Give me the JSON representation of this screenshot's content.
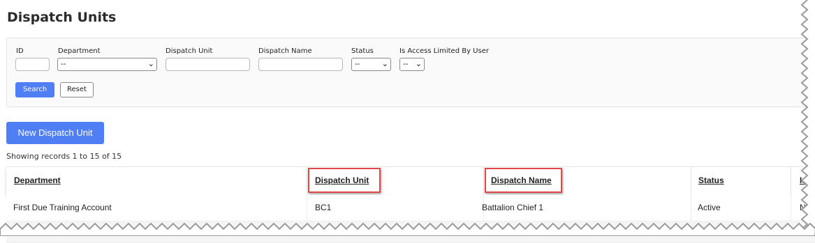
{
  "page": {
    "title": "Dispatch Units"
  },
  "filters": {
    "id_label": "ID",
    "department_label": "Department",
    "department_value": "--",
    "dispatch_unit_label": "Dispatch Unit",
    "dispatch_name_label": "Dispatch Name",
    "status_label": "Status",
    "status_value": "--",
    "access_limited_label": "Is Access Limited By User",
    "access_limited_value": "--",
    "search_label": "Search",
    "reset_label": "Reset"
  },
  "actions": {
    "new_unit_label": "New Dispatch Unit"
  },
  "records": {
    "summary": "Showing records 1 to 15 of 15"
  },
  "table": {
    "columns": [
      "Department",
      "Dispatch Unit",
      "Dispatch Name",
      "Status",
      "Is A"
    ],
    "rows": [
      [
        "First Due Training Account",
        "BC1",
        "Battalion Chief 1",
        "Active",
        "No"
      ]
    ]
  },
  "colors": {
    "primary": "#4f7ef5",
    "highlight": "#e04848"
  }
}
